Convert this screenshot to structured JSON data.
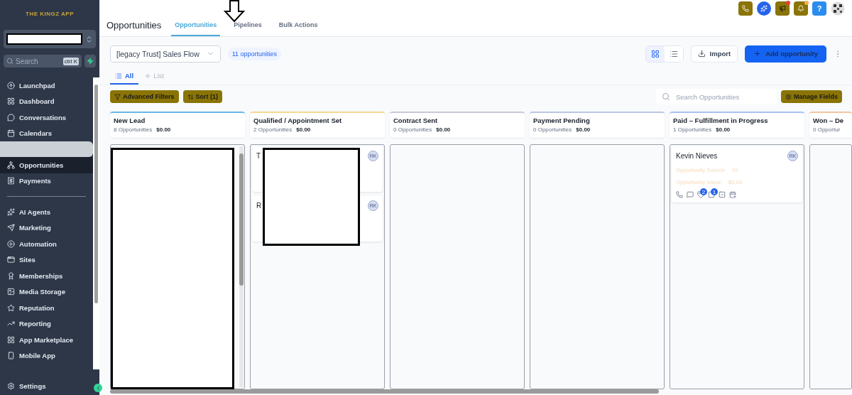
{
  "sidebar": {
    "logo": "THE KINGZ APP",
    "search": {
      "placeholder": "Search",
      "shortcut": "ctrl K"
    },
    "items": [
      {
        "kind": "link",
        "label": "Launchpad",
        "selected": false
      },
      {
        "kind": "link",
        "label": "Dashboard",
        "selected": false
      },
      {
        "kind": "link",
        "label": "Conversations",
        "selected": false
      },
      {
        "kind": "link",
        "label": "Calendars",
        "selected": false
      },
      {
        "kind": "redacted"
      },
      {
        "kind": "link",
        "label": "Opportunities",
        "selected": true
      },
      {
        "kind": "link",
        "label": "Payments",
        "selected": false
      },
      {
        "kind": "divider"
      },
      {
        "kind": "link",
        "label": "AI Agents",
        "selected": false
      },
      {
        "kind": "link",
        "label": "Marketing",
        "selected": false
      },
      {
        "kind": "link",
        "label": "Automation",
        "selected": false
      },
      {
        "kind": "link",
        "label": "Sites",
        "selected": false
      },
      {
        "kind": "link",
        "label": "Memberships",
        "selected": false
      },
      {
        "kind": "link",
        "label": "Media Storage",
        "selected": false
      },
      {
        "kind": "link",
        "label": "Reputation",
        "selected": false
      },
      {
        "kind": "link",
        "label": "Reporting",
        "selected": false
      },
      {
        "kind": "link",
        "label": "App Marketplace",
        "selected": false
      },
      {
        "kind": "link",
        "label": "Mobile App",
        "selected": false
      }
    ],
    "settings": "Settings"
  },
  "header": {
    "title": "Opportunities",
    "tabs": [
      {
        "label": "Opportunities",
        "selected": true
      },
      {
        "label": "Pipelines",
        "selected": false
      },
      {
        "label": "Bulk Actions",
        "selected": false
      }
    ],
    "help": "?"
  },
  "toolbar": {
    "pipeline": "[legacy Trust] Sales Flow",
    "count": "11 opportunities",
    "views": [
      {
        "kind": "grid",
        "selected": true
      },
      {
        "kind": "list",
        "selected": false
      }
    ],
    "import": "Import",
    "add": "Add opportunity"
  },
  "list_tabs": {
    "tabs": [
      {
        "label": "All",
        "selected": true
      }
    ],
    "add": "List"
  },
  "filters": {
    "advanced": "Advanced Filters",
    "sort": "Sort (1)",
    "search_placeholder": "Search Opportunities",
    "manage": "Manage Fields"
  },
  "stages": [
    {
      "name": "New Lead",
      "count": "8 Opportunities",
      "value": "$0.00",
      "color": "#6ab8e6",
      "redacted": true
    },
    {
      "name": "Qualified / Appointment Set",
      "count": "2 Opportunities",
      "value": "$0.00",
      "color": "#f5d890",
      "redacted": true,
      "cards": [
        {
          "title": "T",
          "avatar": "RK"
        },
        {
          "title": "R",
          "avatar": "RK"
        }
      ]
    },
    {
      "name": "Contract Sent",
      "count": "0 Opportunities",
      "value": "$0.00",
      "color": "#c8c8d8",
      "redacted": false
    },
    {
      "name": "Payment Pending",
      "count": "0 Opportunities",
      "value": "$0.00",
      "color": "#b9c6e4",
      "redacted": false
    },
    {
      "name": "Paid – Fulfillment in Progress",
      "count": "1 Opportunities",
      "value": "$0.00",
      "color": "#a9c0f2",
      "redacted": false,
      "cards": [
        {
          "title": "Kevin Nieves",
          "avatar": "RK",
          "source_label": "Opportunity Source:",
          "source": "IG",
          "value_label": "Opportunity Value:",
          "value": "$0.00",
          "tag_count": "2",
          "note_count": "1"
        }
      ]
    },
    {
      "name": "Won – De",
      "count": "0 Opportur",
      "color": "#f2c6a0",
      "redacted": false
    }
  ]
}
